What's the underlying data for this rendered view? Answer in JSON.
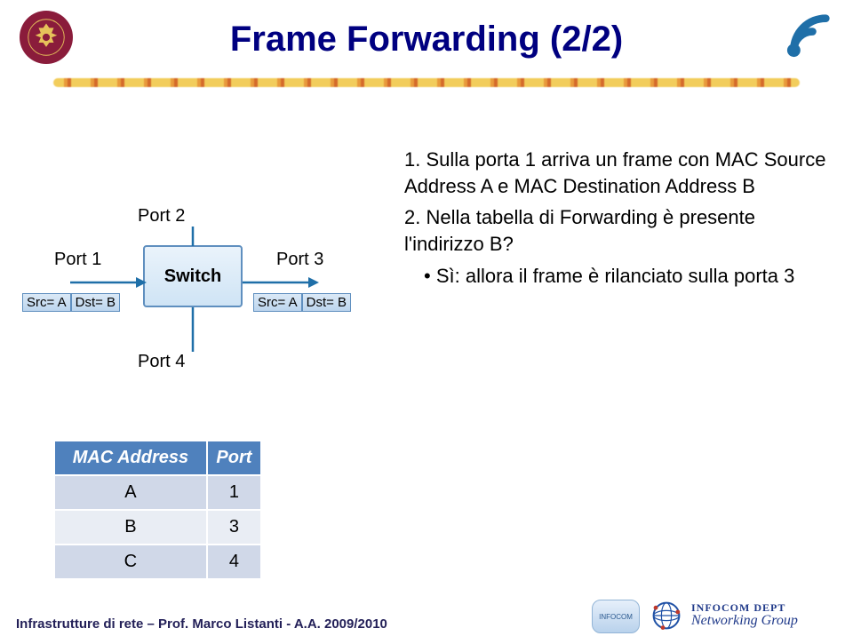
{
  "title": "Frame Forwarding (2/2)",
  "diagram": {
    "port1": "Port 1",
    "port2": "Port 2",
    "port3": "Port 3",
    "port4": "Port 4",
    "switch_label": "Switch",
    "frame_left": {
      "src": "Src= A",
      "dst": "Dst= B"
    },
    "frame_right": {
      "src": "Src= A",
      "dst": "Dst= B"
    }
  },
  "bullets": {
    "item1": "1. Sulla porta 1 arriva un frame con MAC Source Address A e MAC Destination Address B",
    "item2": "2. Nella tabella di Forwarding è presente l'indirizzo B?",
    "item2_sub": "Sì: allora il frame è rilanciato sulla porta 3"
  },
  "table": {
    "headers": {
      "col1": "MAC Address",
      "col2": "Port"
    },
    "rows": [
      {
        "mac": "A",
        "port": "1"
      },
      {
        "mac": "B",
        "port": "3"
      },
      {
        "mac": "C",
        "port": "4"
      }
    ]
  },
  "footer": {
    "text": "Infrastrutture di rete – Prof. Marco Listanti - A.A. 2009/2010",
    "badge1": "INFOCOM",
    "badge2_line1": "INFOCOM DEPT",
    "badge2_line2": "Networking Group"
  }
}
